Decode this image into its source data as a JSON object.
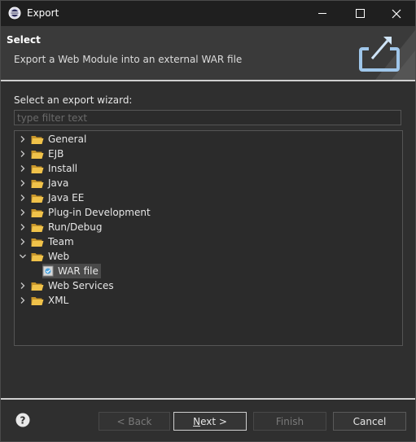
{
  "window": {
    "title": "Export"
  },
  "header": {
    "title": "Select",
    "description": "Export a Web Module into an external WAR file"
  },
  "wizard": {
    "label": "Select an export wizard:",
    "filter_placeholder": "type filter text",
    "tree": [
      {
        "label": "General",
        "expanded": false
      },
      {
        "label": "EJB",
        "expanded": false
      },
      {
        "label": "Install",
        "expanded": false
      },
      {
        "label": "Java",
        "expanded": false
      },
      {
        "label": "Java EE",
        "expanded": false
      },
      {
        "label": "Plug-in Development",
        "expanded": false
      },
      {
        "label": "Run/Debug",
        "expanded": false
      },
      {
        "label": "Team",
        "expanded": false
      },
      {
        "label": "Web",
        "expanded": true,
        "children": [
          {
            "label": "WAR file",
            "selected": true
          }
        ]
      },
      {
        "label": "Web Services",
        "expanded": false
      },
      {
        "label": "XML",
        "expanded": false
      }
    ]
  },
  "buttons": {
    "back": "< Back",
    "next_mnemonic": "N",
    "next_rest": "ext >",
    "finish": "Finish",
    "cancel": "Cancel"
  }
}
